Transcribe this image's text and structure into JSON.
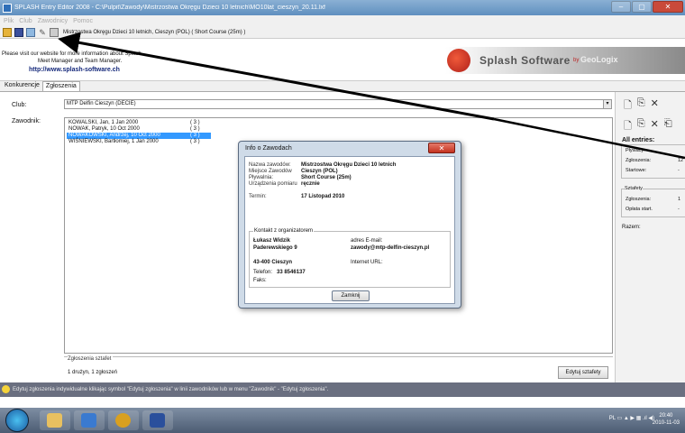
{
  "window": {
    "title": "SPLASH Entry Editor 2008 - C:\\Pulpit\\Zawody\\Mistrzostwa Okręgu Dzieci 10 letnich\\MO10lat_cieszyn_20.11.lxf",
    "controls": [
      "–",
      "▢",
      "✕"
    ]
  },
  "menu": [
    "Plik",
    "Club",
    "Zawodnicy",
    "Pomoc"
  ],
  "toolbar": {
    "meet_text": "Mistrzostwa Okręgu Dzieci 10 letnich,  Cieszyn  (POL)  ( Short Course (25m) )"
  },
  "banner": {
    "visit_line1": "Please visit our website for more information about Splash",
    "visit_line2": "Meet Manager and Team Manager.",
    "url": "http://www.splash-software.ch",
    "logo_name": "Splash Software",
    "logo_by": "by",
    "logo_geo": "GeoLogix"
  },
  "tabs": [
    "Konkurencje",
    "Zgłoszenia"
  ],
  "club": {
    "label": "Club:",
    "value": "MTP Delfin Cieszyn (DECIE)",
    "arrow": "▾"
  },
  "swimmers": {
    "label": "Zawodnik:",
    "rows": [
      {
        "name": "KOWALSKI, Jan, 1 Jan 2000",
        "count": "( 3 )"
      },
      {
        "name": "NOWAK, Patryk, 10 Oct 2000",
        "count": "( 3 )"
      },
      {
        "name": "NOWAKOWSKI, Andrzej, 10 Oct 2000",
        "count": "( 3 )"
      },
      {
        "name": "WIŚNIEWSKI, Bartłomiej, 1 Jan 2000",
        "count": "( 3 )"
      }
    ],
    "selected_index": 2
  },
  "relays": {
    "title": "Zgłoszenia sztafet",
    "text": "1 drużyn, 1 zgłoszeń",
    "edit_button": "Edytuj sztafety"
  },
  "right_panel": {
    "icons_top": [
      "🗋",
      "⎘",
      "✕"
    ],
    "icons_mid": [
      "🗋",
      "⎘",
      "✕",
      "⎗"
    ],
    "all_entries_title": "All entries:",
    "entries": [
      {
        "label": "Pływacy:",
        "value": ""
      },
      {
        "label": "Zgłoszenia:",
        "value": "12"
      },
      {
        "label": "Startowe:",
        "value": "-"
      }
    ],
    "relays_title": "Sztafety",
    "relays": [
      {
        "label": "Zgłoszenia:",
        "value": "1"
      },
      {
        "label": "Opłata start.",
        "value": "-"
      }
    ],
    "total_label": "Razem:"
  },
  "hint": {
    "text": "Edytuj zgłoszenia indywidualne klikając symbol \"Edytuj zgłoszenia\" w linii zawodników lub w menu \"Zawodnik\" - \"Edytuj zgłoszenia\"."
  },
  "dialog": {
    "title": "Info o Zawodach",
    "close": "✕",
    "fields": [
      {
        "label": "Nazwa zawodów:",
        "value": "Mistrzostwa Okręgu Dzieci 10 letnich"
      },
      {
        "label": "Miejsce Zawodów",
        "value": "Cieszyn  (POL)"
      },
      {
        "label": "Pływalnia:",
        "value": "Short Course (25m)"
      },
      {
        "label": "Urządzenia pomiaru",
        "value": "ręcznie"
      }
    ],
    "date_label": "Termin:",
    "date_value": "17 Listopad 2010",
    "contact": {
      "title": "Kontakt z organizatorem",
      "name": "Łukasz Widzik",
      "street": "Paderewskiego 9",
      "city": "43-400 Cieszyn",
      "phone_label": "Telefon:",
      "phone": "33 8546137",
      "fax_label": "Faks:",
      "email_label": "adres E-mail:",
      "email": "zawody@mtp-delfin-cieszyn.pl",
      "url_label": "Internet URL:"
    },
    "ok_button": "Zamknij"
  },
  "taskbar": {
    "tray": "PL  ▭  ▲  ▶  ▦  .ıl  ◀)",
    "time": "20:40",
    "date": "2010-11-03"
  }
}
